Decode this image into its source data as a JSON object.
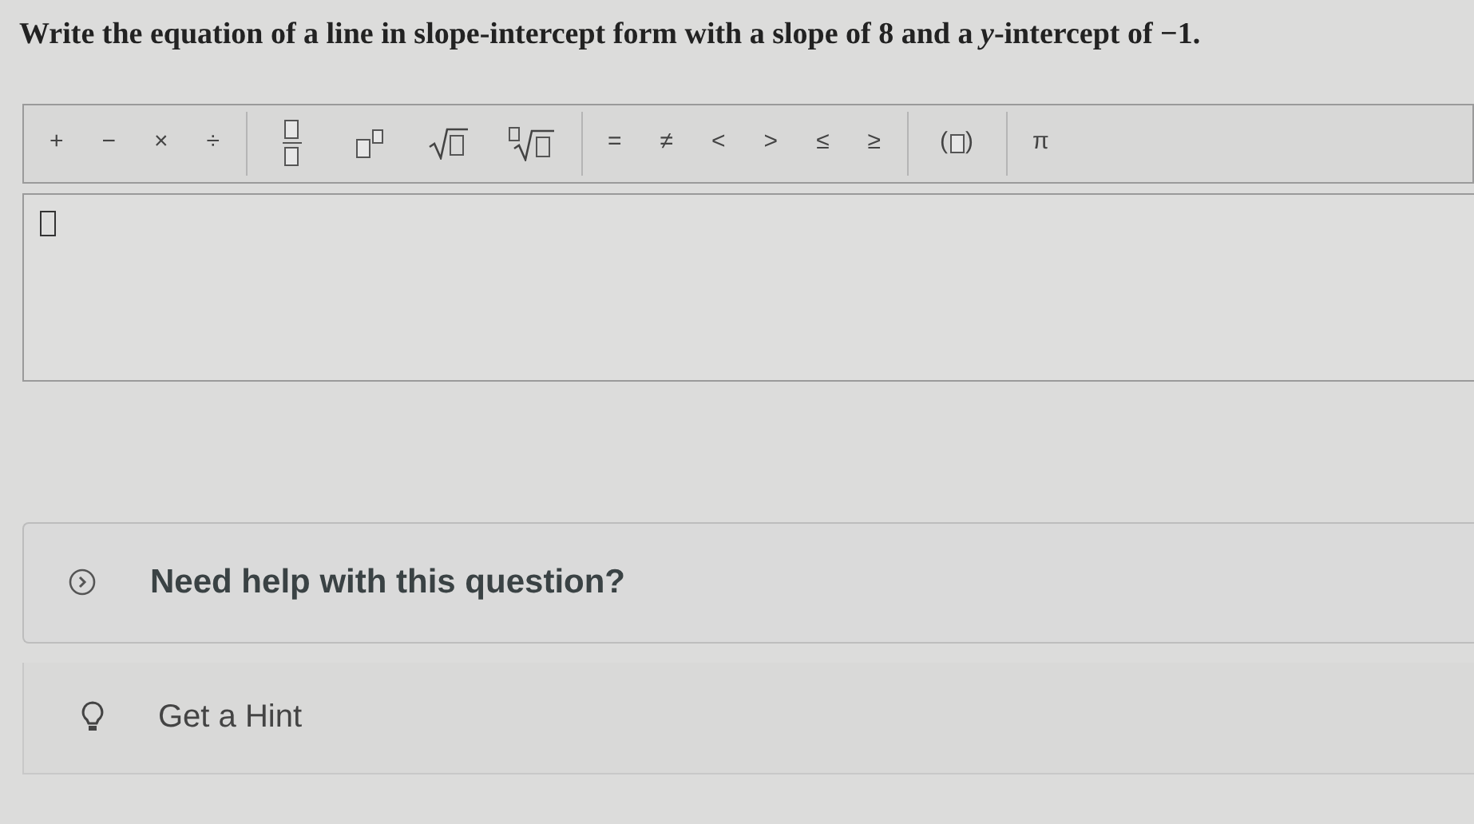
{
  "question": "Write the equation of a line in slope-intercept form with a slope of 8 and a *y*-intercept of −1.",
  "toolbar": {
    "groups": [
      [
        {
          "kind": "symbol",
          "label": "+"
        },
        {
          "kind": "symbol",
          "label": "−"
        },
        {
          "kind": "symbol",
          "label": "×"
        },
        {
          "kind": "symbol",
          "label": "÷"
        }
      ],
      [
        {
          "kind": "fraction"
        },
        {
          "kind": "power"
        },
        {
          "kind": "sqrt"
        },
        {
          "kind": "root"
        }
      ],
      [
        {
          "kind": "symbol",
          "label": "="
        },
        {
          "kind": "symbol",
          "label": "≠"
        },
        {
          "kind": "symbol",
          "label": "<"
        },
        {
          "kind": "symbol",
          "label": ">"
        },
        {
          "kind": "symbol",
          "label": "≤"
        },
        {
          "kind": "symbol",
          "label": "≥"
        }
      ],
      [
        {
          "kind": "parens",
          "open": "(",
          "close": ")"
        }
      ],
      [
        {
          "kind": "symbol",
          "label": "π"
        }
      ]
    ]
  },
  "help": {
    "title": "Need help with this question?",
    "expanded": false
  },
  "hint": {
    "label": "Get a Hint"
  }
}
